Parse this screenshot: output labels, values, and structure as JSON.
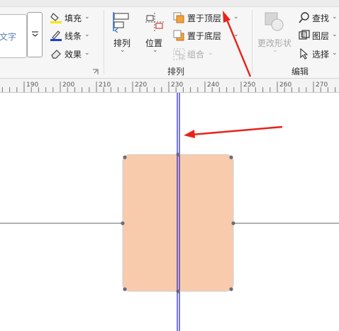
{
  "ribbon": {
    "textbox_label": "文字",
    "fill_label": "填充",
    "line_label": "线条",
    "effect_label": "效果",
    "arrange_label": "排列",
    "position_label": "位置",
    "bring_to_front_label": "置于顶层",
    "send_to_back_label": "置于底层",
    "group_label": "组合",
    "change_shape_label": "更改形状",
    "find_label": "查找",
    "layers_label": "图层",
    "select_label": "选择",
    "arrange_group_title": "排列",
    "edit_group_title": "编辑",
    "colors": {
      "fill_swatch": "#f5e600",
      "line_swatch": "#1f3fd1",
      "bring_front_icon": "#f2a33a"
    }
  },
  "ruler": {
    "labels": [
      "190",
      "200",
      "210",
      "220",
      "230",
      "240",
      "250",
      "260",
      "270"
    ]
  },
  "canvas": {
    "shape_fill": "#f8cbad",
    "guide_color": "#2c2ccc",
    "arrow_color": "#e8231c"
  }
}
